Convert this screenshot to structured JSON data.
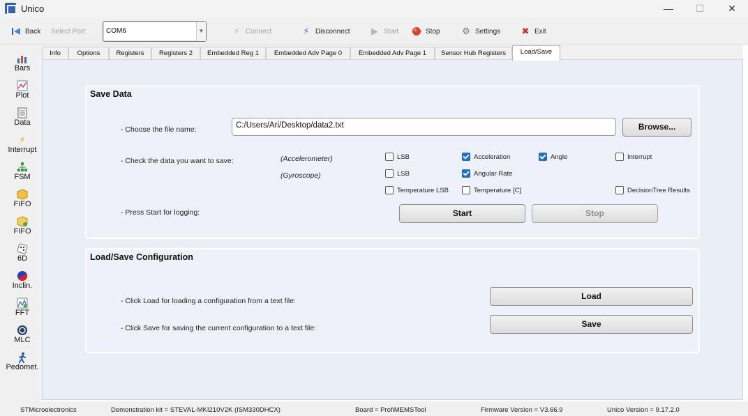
{
  "window": {
    "title": "Unico",
    "minimize_glyph": "—",
    "maximize_glyph": "☐",
    "close_glyph": "✕"
  },
  "toolbar": {
    "back_label": "Back",
    "select_port_label": "Select Port:",
    "port_value": "COM6",
    "connect_label": "Connect",
    "disconnect_label": "Disconnect",
    "start_label": "Start",
    "stop_label": "Stop",
    "settings_label": "Settings",
    "exit_label": "Exit"
  },
  "sidebar": {
    "items": [
      {
        "label": "Bars",
        "icon": "bars-chart-icon"
      },
      {
        "label": "Plot",
        "icon": "plot-icon"
      },
      {
        "label": "Data",
        "icon": "data-icon"
      },
      {
        "label": "Interrupt",
        "icon": "interrupt-icon"
      },
      {
        "label": "FSM",
        "icon": "fsm-icon"
      },
      {
        "label": "FIFO",
        "icon": "fifo-icon"
      },
      {
        "label": "FIFO",
        "icon": "fifo-icon"
      },
      {
        "label": "6D",
        "icon": "dice-icon"
      },
      {
        "label": "Inclin.",
        "icon": "inclination-icon"
      },
      {
        "label": "FFT",
        "icon": "fft-icon"
      },
      {
        "label": "MLC",
        "icon": "mlc-icon"
      },
      {
        "label": "Pedomet.",
        "icon": "pedometer-icon"
      }
    ]
  },
  "tabs": [
    {
      "label": "Info"
    },
    {
      "label": "Options"
    },
    {
      "label": "Registers"
    },
    {
      "label": "Registers 2"
    },
    {
      "label": "Embedded Reg 1"
    },
    {
      "label": "Embedded Adv Page 0"
    },
    {
      "label": "Embedded Adv Page 1"
    },
    {
      "label": "Sensor Hub Registers"
    },
    {
      "label": "Load/Save"
    }
  ],
  "active_tab": "Load/Save",
  "save_data": {
    "title": "Save Data",
    "file_label": "- Choose the file name:",
    "file_value": "C:/Users/Ari/Desktop/data2.txt",
    "browse_label": "Browse...",
    "check_label": "- Check the data you want to save:",
    "accelerometer_label": "(Accelerometer)",
    "gyroscope_label": "(Gyroscope)",
    "checkboxes": [
      {
        "label": "LSB",
        "checked": false
      },
      {
        "label": "Acceleration",
        "checked": true
      },
      {
        "label": "Angle",
        "checked": true
      },
      {
        "label": "Interrupt",
        "checked": false
      },
      {
        "label": "LSB",
        "checked": false
      },
      {
        "label": "Angular Rate",
        "checked": true
      },
      {
        "label": "Temperature LSB",
        "checked": false
      },
      {
        "label": "Temperature [C]",
        "checked": false
      },
      {
        "label": "DecisionTree Results",
        "checked": false
      }
    ],
    "start_prompt": "- Press Start for logging:",
    "start_label": "Start",
    "stop_label": "Stop"
  },
  "config": {
    "title": "Load/Save Configuration",
    "load_text": "- Click Load for loading a configuration from a text file:",
    "save_text": "- Click Save for saving the current configuration to a text file:",
    "load_label": "Load",
    "save_label": "Save"
  },
  "status": {
    "company": "STMicroelectronics",
    "kit": "Demonstration kit = STEVAL-MKI210V2K (ISM330DHCX)",
    "board": "Board = ProfiMEMSTool",
    "firmware": "Firmware Version = V3.66.9",
    "unico": "Unico Version = 9.17.2.0"
  },
  "colors": {
    "accent": "#1f6fc7",
    "panel": "#eaeef7",
    "group": "#eef1f9"
  }
}
